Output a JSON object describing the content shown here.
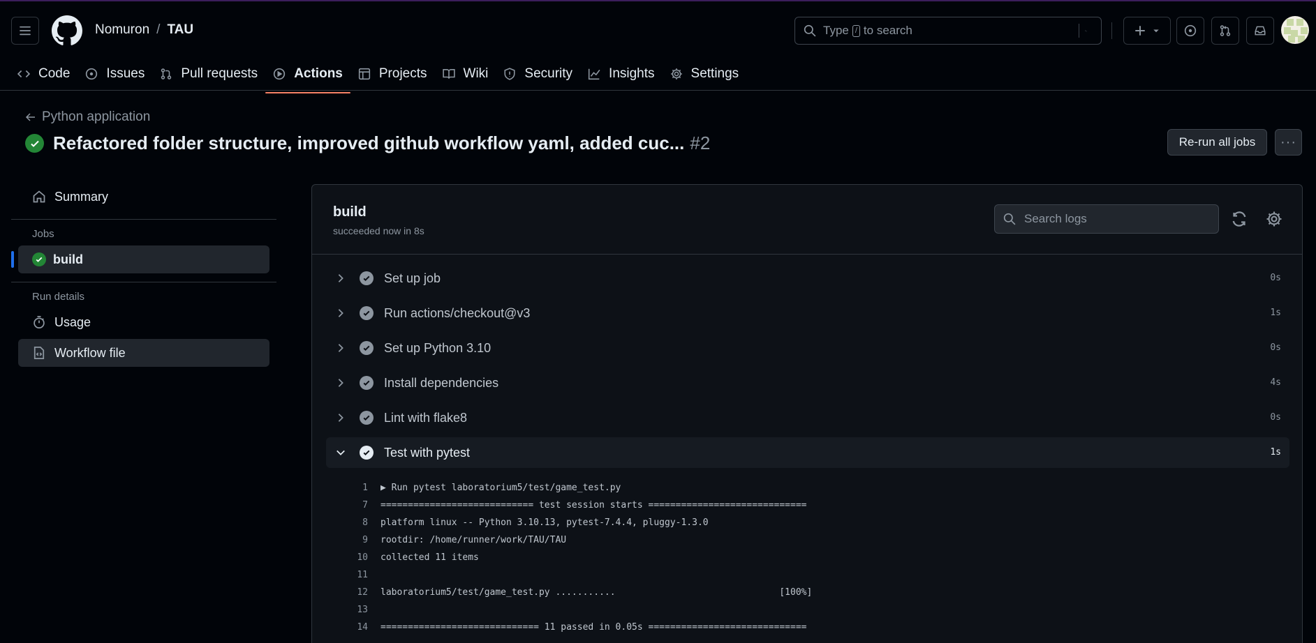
{
  "header": {
    "owner": "Nomuron",
    "separator": "/",
    "repo": "TAU",
    "search_prefix": "Type",
    "search_key": "/",
    "search_suffix": "to search"
  },
  "tabs": [
    {
      "label": "Code"
    },
    {
      "label": "Issues"
    },
    {
      "label": "Pull requests"
    },
    {
      "label": "Actions"
    },
    {
      "label": "Projects"
    },
    {
      "label": "Wiki"
    },
    {
      "label": "Security"
    },
    {
      "label": "Insights"
    },
    {
      "label": "Settings"
    }
  ],
  "run": {
    "back_label": "Python application",
    "title": "Refactored folder structure, improved github workflow yaml, added cuc...",
    "number": "#2",
    "rerun_label": "Re-run all jobs",
    "more_label": "···"
  },
  "sidebar": {
    "summary": "Summary",
    "jobs_heading": "Jobs",
    "job": "build",
    "run_details_heading": "Run details",
    "usage": "Usage",
    "workflow_file": "Workflow file"
  },
  "job": {
    "name": "build",
    "status": "succeeded now in 8s",
    "search_placeholder": "Search logs",
    "steps": [
      {
        "name": "Set up job",
        "duration": "0s"
      },
      {
        "name": "Run actions/checkout@v3",
        "duration": "1s"
      },
      {
        "name": "Set up Python 3.10",
        "duration": "0s"
      },
      {
        "name": "Install dependencies",
        "duration": "4s"
      },
      {
        "name": "Lint with flake8",
        "duration": "0s"
      },
      {
        "name": "Test with pytest",
        "duration": "1s"
      }
    ],
    "log": [
      {
        "n": "1",
        "text": "▶ Run pytest laboratorium5/test/game_test.py"
      },
      {
        "n": "7",
        "text": "============================ test session starts ============================="
      },
      {
        "n": "8",
        "text": "platform linux -- Python 3.10.13, pytest-7.4.4, pluggy-1.3.0"
      },
      {
        "n": "9",
        "text": "rootdir: /home/runner/work/TAU/TAU"
      },
      {
        "n": "10",
        "text": "collected 11 items"
      },
      {
        "n": "11",
        "text": ""
      },
      {
        "n": "12",
        "text": "laboratorium5/test/game_test.py ...........                              [100%]"
      },
      {
        "n": "13",
        "text": ""
      },
      {
        "n": "14",
        "text": "============================= 11 passed in 0.05s ============================="
      }
    ]
  },
  "colors": {
    "background": "#010409",
    "panel": "#0d1117",
    "success": "#238636",
    "active_tab_underline": "#f78166",
    "selection_indicator": "#1f6feb"
  }
}
